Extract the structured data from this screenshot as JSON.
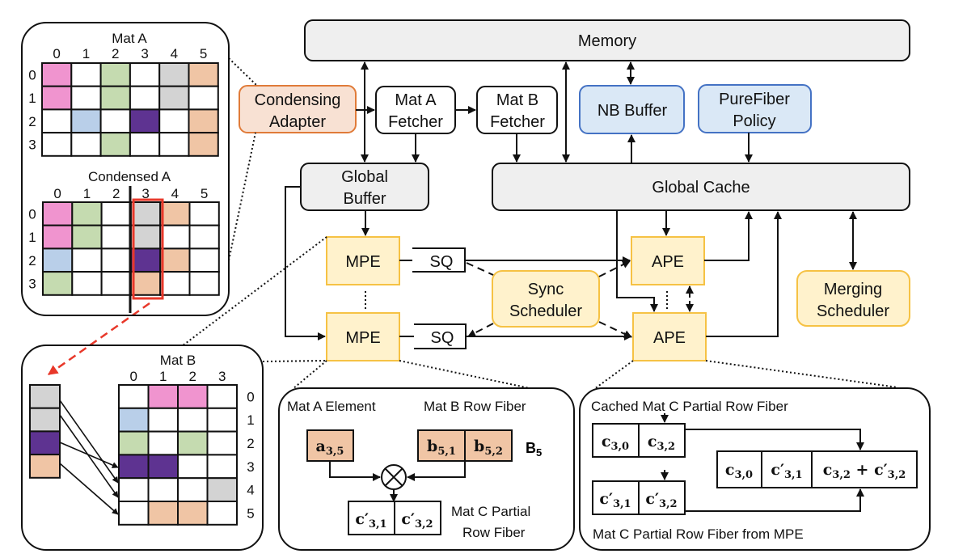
{
  "colors": {
    "p": "#f094cf",
    "g": "#c5dbb0",
    "y": "#d3d3d3",
    "s": "#f0c5a5",
    "b": "#b9cfe9",
    "v": "#5e3391",
    "w": "#ffffff",
    "orange_fill": "#f8e1d3",
    "orange_stroke": "#e07b39",
    "blue_fill": "#dae8f6",
    "blue_stroke": "#4472c4",
    "yellow_fill": "#fff2cc",
    "yellow_stroke": "#f6c244",
    "gray_fill": "#efefef",
    "red": "#e8382a"
  },
  "blocks": {
    "memory": "Memory",
    "condensing": [
      "Condensing",
      "Adapter"
    ],
    "mat_a_fetcher": [
      "Mat A",
      "Fetcher"
    ],
    "mat_b_fetcher": [
      "Mat B",
      "Fetcher"
    ],
    "nb_buffer": "NB Buffer",
    "purefiber": [
      "PureFiber",
      "Policy"
    ],
    "global_buffer": [
      "Global",
      "Buffer"
    ],
    "global_cache": "Global Cache",
    "mpe": "MPE",
    "sq": "SQ",
    "ape": "APE",
    "sync": [
      "Sync",
      "Scheduler"
    ],
    "merging": [
      "Merging",
      "Scheduler"
    ]
  },
  "mat_a": {
    "title": "Mat A",
    "cols": [
      "0",
      "1",
      "2",
      "3",
      "4",
      "5"
    ],
    "rows": [
      "0",
      "1",
      "2",
      "3"
    ],
    "cells": [
      [
        "p",
        "w",
        "g",
        "w",
        "y",
        "s"
      ],
      [
        "p",
        "w",
        "g",
        "w",
        "y",
        "w"
      ],
      [
        "w",
        "b",
        "w",
        "v",
        "w",
        "s"
      ],
      [
        "w",
        "w",
        "g",
        "w",
        "w",
        "s"
      ]
    ]
  },
  "condensed_a": {
    "title": "Condensed A",
    "cols": [
      "0",
      "1",
      "2",
      "3",
      "4",
      "5"
    ],
    "rows": [
      "0",
      "1",
      "2",
      "3"
    ],
    "cells": [
      [
        "p",
        "g",
        "w",
        "y",
        "s",
        "w"
      ],
      [
        "p",
        "g",
        "w",
        "y",
        "w",
        "w"
      ],
      [
        "b",
        "w",
        "w",
        "v",
        "s",
        "w"
      ],
      [
        "g",
        "w",
        "w",
        "s",
        "w",
        "w"
      ]
    ]
  },
  "mat_b": {
    "title": "Mat B",
    "cols": [
      "0",
      "1",
      "2",
      "3"
    ],
    "rows": [
      "0",
      "1",
      "2",
      "3",
      "4",
      "5"
    ],
    "cells": [
      [
        "w",
        "p",
        "p",
        "w"
      ],
      [
        "b",
        "w",
        "w",
        "w"
      ],
      [
        "g",
        "w",
        "g",
        "w"
      ],
      [
        "v",
        "v",
        "w",
        "w"
      ],
      [
        "w",
        "w",
        "w",
        "y"
      ],
      [
        "w",
        "s",
        "s",
        "w"
      ]
    ]
  },
  "column_strip": [
    "y",
    "y",
    "v",
    "s"
  ],
  "mpe_detail": {
    "mat_a_label": "Mat A Element",
    "mat_b_label": "Mat B Row Fiber",
    "b_row": "B",
    "b_row_sub": "5",
    "a": {
      "base": "a",
      "sub": "3,5"
    },
    "b": [
      {
        "base": "b",
        "sub": "5,1"
      },
      {
        "base": "b",
        "sub": "5,2"
      }
    ],
    "c": [
      {
        "base": "c′",
        "sub": "3,1"
      },
      {
        "base": "c′",
        "sub": "3,2"
      }
    ],
    "out_label": [
      "Mat C Partial",
      "Row Fiber"
    ]
  },
  "ape_detail": {
    "cached_label": "Cached Mat C Partial Row Fiber",
    "mpe_label": "Mat C Partial Row Fiber from MPE",
    "cached": [
      {
        "base": "c",
        "sub": "3,0"
      },
      {
        "base": "c",
        "sub": "3,2"
      }
    ],
    "partial": [
      {
        "base": "c′",
        "sub": "3,1"
      },
      {
        "base": "c′",
        "sub": "3,2"
      }
    ],
    "result": [
      {
        "base": "c",
        "sub": "3,0"
      },
      {
        "base": "c′",
        "sub": "3,1"
      },
      {
        "base": "c",
        "sub": "3,2",
        "plus": " + c′",
        "sub2": "3,2"
      }
    ]
  }
}
